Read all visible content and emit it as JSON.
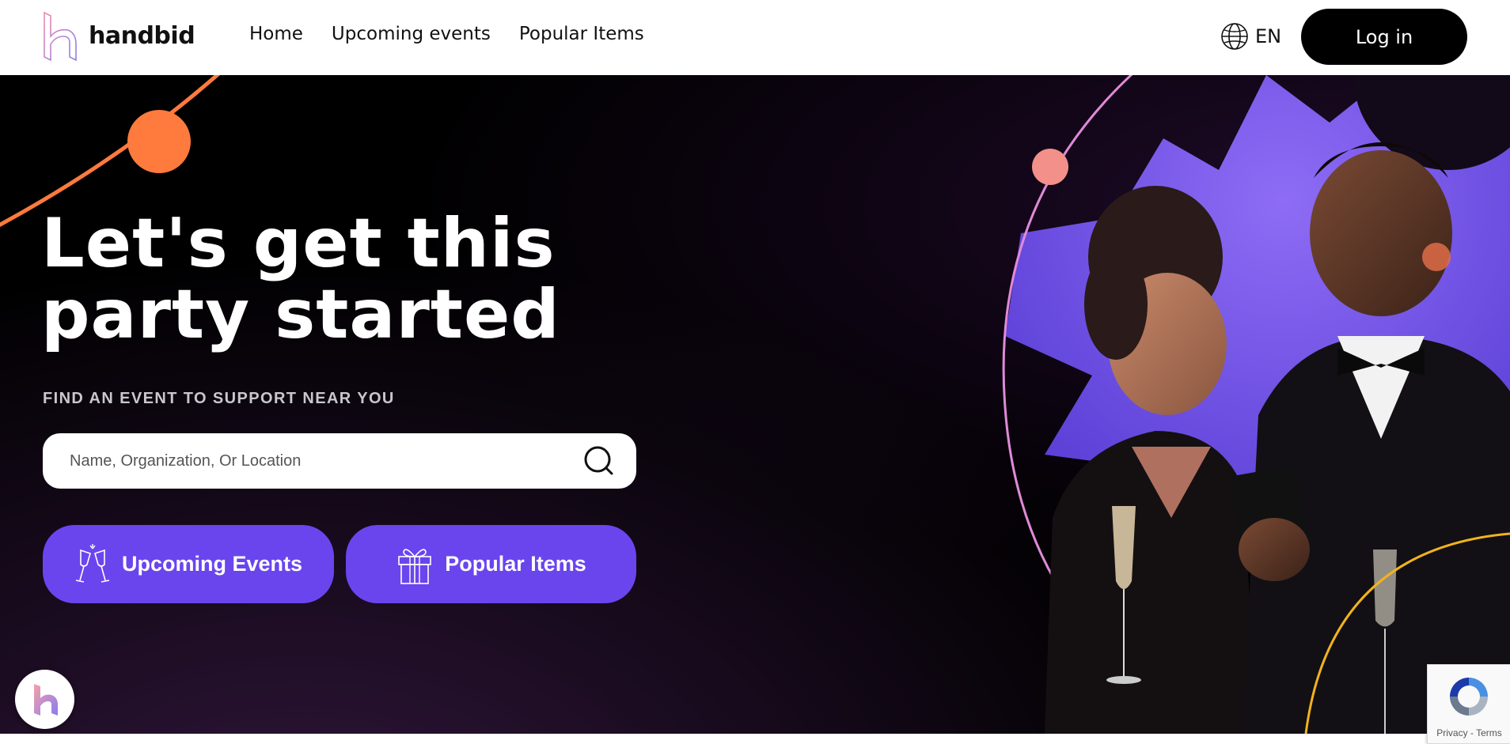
{
  "header": {
    "brand": "handbid",
    "nav": [
      {
        "label": "Home"
      },
      {
        "label": "Upcoming events"
      },
      {
        "label": "Popular Items"
      }
    ],
    "language": "EN",
    "login_label": "Log in"
  },
  "hero": {
    "headline_line1": "Let's get this",
    "headline_line2": "party started",
    "subline": "FIND AN EVENT TO SUPPORT NEAR YOU",
    "search_placeholder": "Name, Organization, Or Location",
    "cta_events": "Upcoming Events",
    "cta_items": "Popular Items"
  },
  "recaptcha": {
    "privacy": "Privacy",
    "separator": " - ",
    "terms": "Terms"
  },
  "colors": {
    "accent_purple": "#6a45ee",
    "hero_background": "#000000",
    "orange_decor": "#ff7a3d",
    "pink_ring": "#e08ad8",
    "yellow_ring": "#f2b31c"
  },
  "icons": {
    "language": "globe-icon",
    "search": "search-icon",
    "events": "champagne-glasses-icon",
    "items": "gift-icon",
    "chat": "handbid-chat-icon",
    "recaptcha": "recaptcha-icon"
  }
}
